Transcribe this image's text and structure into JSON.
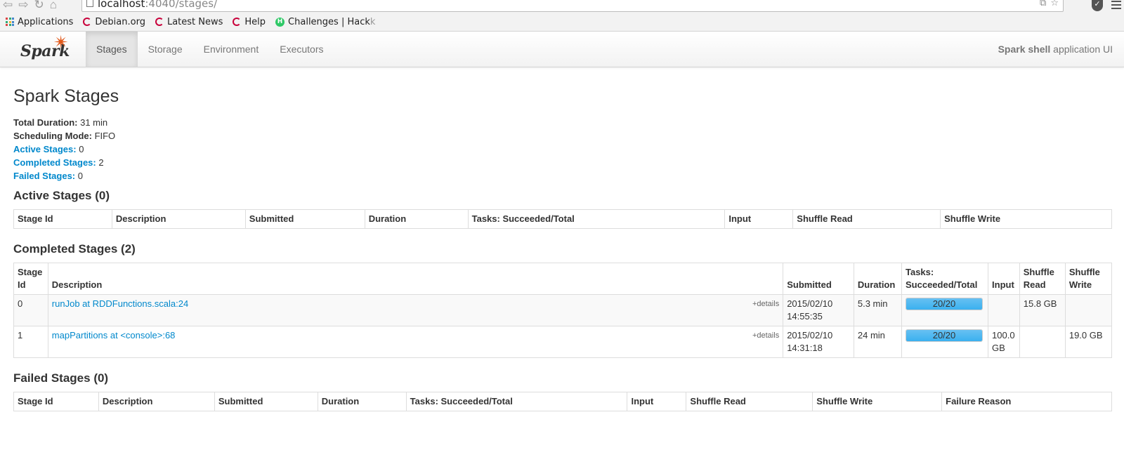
{
  "browser": {
    "url_host": "localhost",
    "url_path": ":4040/stages/",
    "bookmarks": [
      {
        "label": "Applications",
        "icon": "apps-grid-icon"
      },
      {
        "label": "Debian.org",
        "icon": "debian-swirl-icon"
      },
      {
        "label": "Latest News",
        "icon": "debian-swirl-icon"
      },
      {
        "label": "Help",
        "icon": "debian-swirl-icon"
      },
      {
        "label": "Challenges | Hack",
        "label_fade": "k",
        "icon": "hackerrank-icon"
      }
    ]
  },
  "navbar": {
    "brand": "Spark",
    "tabs": [
      {
        "label": "Stages",
        "active": true
      },
      {
        "label": "Storage",
        "active": false
      },
      {
        "label": "Environment",
        "active": false
      },
      {
        "label": "Executors",
        "active": false
      }
    ],
    "app_name": "Spark shell",
    "app_suffix": " application UI"
  },
  "page": {
    "title": "Spark Stages",
    "summary": {
      "total_duration_label": "Total Duration:",
      "total_duration": " 31 min",
      "scheduling_mode_label": "Scheduling Mode:",
      "scheduling_mode": " FIFO",
      "active_stages_label": "Active Stages:",
      "active_stages": " 0",
      "completed_stages_label": "Completed Stages:",
      "completed_stages": " 2",
      "failed_stages_label": "Failed Stages:",
      "failed_stages": " 0"
    }
  },
  "active": {
    "heading": "Active Stages (0)",
    "columns": [
      "Stage Id",
      "Description",
      "Submitted",
      "Duration",
      "Tasks: Succeeded/Total",
      "Input",
      "Shuffle Read",
      "Shuffle Write"
    ]
  },
  "completed": {
    "heading": "Completed Stages (2)",
    "columns": [
      "Stage Id",
      "Description",
      "Submitted",
      "Duration",
      "Tasks: Succeeded/Total",
      "Input",
      "Shuffle Read",
      "Shuffle Write"
    ],
    "details_label": "+details",
    "rows": [
      {
        "id": "0",
        "description": "runJob at RDDFunctions.scala:24",
        "submitted": "2015/02/10 14:55:35",
        "duration": "5.3 min",
        "tasks": "20/20",
        "tasks_fraction": 1.0,
        "input": "",
        "shuffle_read": "15.8 GB",
        "shuffle_write": ""
      },
      {
        "id": "1",
        "description": "mapPartitions at <console>:68",
        "submitted": "2015/02/10 14:31:18",
        "duration": "24 min",
        "tasks": "20/20",
        "tasks_fraction": 1.0,
        "input": "100.0 GB",
        "shuffle_read": "",
        "shuffle_write": "19.0 GB"
      }
    ]
  },
  "failed": {
    "heading": "Failed Stages (0)",
    "columns": [
      "Stage Id",
      "Description",
      "Submitted",
      "Duration",
      "Tasks: Succeeded/Total",
      "Input",
      "Shuffle Read",
      "Shuffle Write",
      "Failure Reason"
    ]
  },
  "colors": {
    "link": "#0088cc",
    "progress_bar": "#3ab0ef",
    "spark_orange": "#e25a1c"
  }
}
